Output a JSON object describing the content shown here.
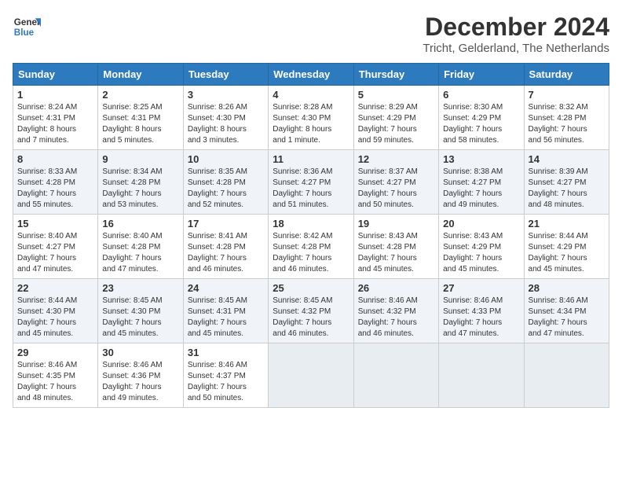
{
  "header": {
    "logo_line1": "General",
    "logo_line2": "Blue",
    "main_title": "December 2024",
    "subtitle": "Tricht, Gelderland, The Netherlands"
  },
  "weekdays": [
    "Sunday",
    "Monday",
    "Tuesday",
    "Wednesday",
    "Thursday",
    "Friday",
    "Saturday"
  ],
  "weeks": [
    [
      {
        "day": "1",
        "info": "Sunrise: 8:24 AM\nSunset: 4:31 PM\nDaylight: 8 hours\nand 7 minutes."
      },
      {
        "day": "2",
        "info": "Sunrise: 8:25 AM\nSunset: 4:31 PM\nDaylight: 8 hours\nand 5 minutes."
      },
      {
        "day": "3",
        "info": "Sunrise: 8:26 AM\nSunset: 4:30 PM\nDaylight: 8 hours\nand 3 minutes."
      },
      {
        "day": "4",
        "info": "Sunrise: 8:28 AM\nSunset: 4:30 PM\nDaylight: 8 hours\nand 1 minute."
      },
      {
        "day": "5",
        "info": "Sunrise: 8:29 AM\nSunset: 4:29 PM\nDaylight: 7 hours\nand 59 minutes."
      },
      {
        "day": "6",
        "info": "Sunrise: 8:30 AM\nSunset: 4:29 PM\nDaylight: 7 hours\nand 58 minutes."
      },
      {
        "day": "7",
        "info": "Sunrise: 8:32 AM\nSunset: 4:28 PM\nDaylight: 7 hours\nand 56 minutes."
      }
    ],
    [
      {
        "day": "8",
        "info": "Sunrise: 8:33 AM\nSunset: 4:28 PM\nDaylight: 7 hours\nand 55 minutes."
      },
      {
        "day": "9",
        "info": "Sunrise: 8:34 AM\nSunset: 4:28 PM\nDaylight: 7 hours\nand 53 minutes."
      },
      {
        "day": "10",
        "info": "Sunrise: 8:35 AM\nSunset: 4:28 PM\nDaylight: 7 hours\nand 52 minutes."
      },
      {
        "day": "11",
        "info": "Sunrise: 8:36 AM\nSunset: 4:27 PM\nDaylight: 7 hours\nand 51 minutes."
      },
      {
        "day": "12",
        "info": "Sunrise: 8:37 AM\nSunset: 4:27 PM\nDaylight: 7 hours\nand 50 minutes."
      },
      {
        "day": "13",
        "info": "Sunrise: 8:38 AM\nSunset: 4:27 PM\nDaylight: 7 hours\nand 49 minutes."
      },
      {
        "day": "14",
        "info": "Sunrise: 8:39 AM\nSunset: 4:27 PM\nDaylight: 7 hours\nand 48 minutes."
      }
    ],
    [
      {
        "day": "15",
        "info": "Sunrise: 8:40 AM\nSunset: 4:27 PM\nDaylight: 7 hours\nand 47 minutes."
      },
      {
        "day": "16",
        "info": "Sunrise: 8:40 AM\nSunset: 4:28 PM\nDaylight: 7 hours\nand 47 minutes."
      },
      {
        "day": "17",
        "info": "Sunrise: 8:41 AM\nSunset: 4:28 PM\nDaylight: 7 hours\nand 46 minutes."
      },
      {
        "day": "18",
        "info": "Sunrise: 8:42 AM\nSunset: 4:28 PM\nDaylight: 7 hours\nand 46 minutes."
      },
      {
        "day": "19",
        "info": "Sunrise: 8:43 AM\nSunset: 4:28 PM\nDaylight: 7 hours\nand 45 minutes."
      },
      {
        "day": "20",
        "info": "Sunrise: 8:43 AM\nSunset: 4:29 PM\nDaylight: 7 hours\nand 45 minutes."
      },
      {
        "day": "21",
        "info": "Sunrise: 8:44 AM\nSunset: 4:29 PM\nDaylight: 7 hours\nand 45 minutes."
      }
    ],
    [
      {
        "day": "22",
        "info": "Sunrise: 8:44 AM\nSunset: 4:30 PM\nDaylight: 7 hours\nand 45 minutes."
      },
      {
        "day": "23",
        "info": "Sunrise: 8:45 AM\nSunset: 4:30 PM\nDaylight: 7 hours\nand 45 minutes."
      },
      {
        "day": "24",
        "info": "Sunrise: 8:45 AM\nSunset: 4:31 PM\nDaylight: 7 hours\nand 45 minutes."
      },
      {
        "day": "25",
        "info": "Sunrise: 8:45 AM\nSunset: 4:32 PM\nDaylight: 7 hours\nand 46 minutes."
      },
      {
        "day": "26",
        "info": "Sunrise: 8:46 AM\nSunset: 4:32 PM\nDaylight: 7 hours\nand 46 minutes."
      },
      {
        "day": "27",
        "info": "Sunrise: 8:46 AM\nSunset: 4:33 PM\nDaylight: 7 hours\nand 47 minutes."
      },
      {
        "day": "28",
        "info": "Sunrise: 8:46 AM\nSunset: 4:34 PM\nDaylight: 7 hours\nand 47 minutes."
      }
    ],
    [
      {
        "day": "29",
        "info": "Sunrise: 8:46 AM\nSunset: 4:35 PM\nDaylight: 7 hours\nand 48 minutes."
      },
      {
        "day": "30",
        "info": "Sunrise: 8:46 AM\nSunset: 4:36 PM\nDaylight: 7 hours\nand 49 minutes."
      },
      {
        "day": "31",
        "info": "Sunrise: 8:46 AM\nSunset: 4:37 PM\nDaylight: 7 hours\nand 50 minutes."
      },
      {
        "day": "",
        "info": ""
      },
      {
        "day": "",
        "info": ""
      },
      {
        "day": "",
        "info": ""
      },
      {
        "day": "",
        "info": ""
      }
    ]
  ]
}
